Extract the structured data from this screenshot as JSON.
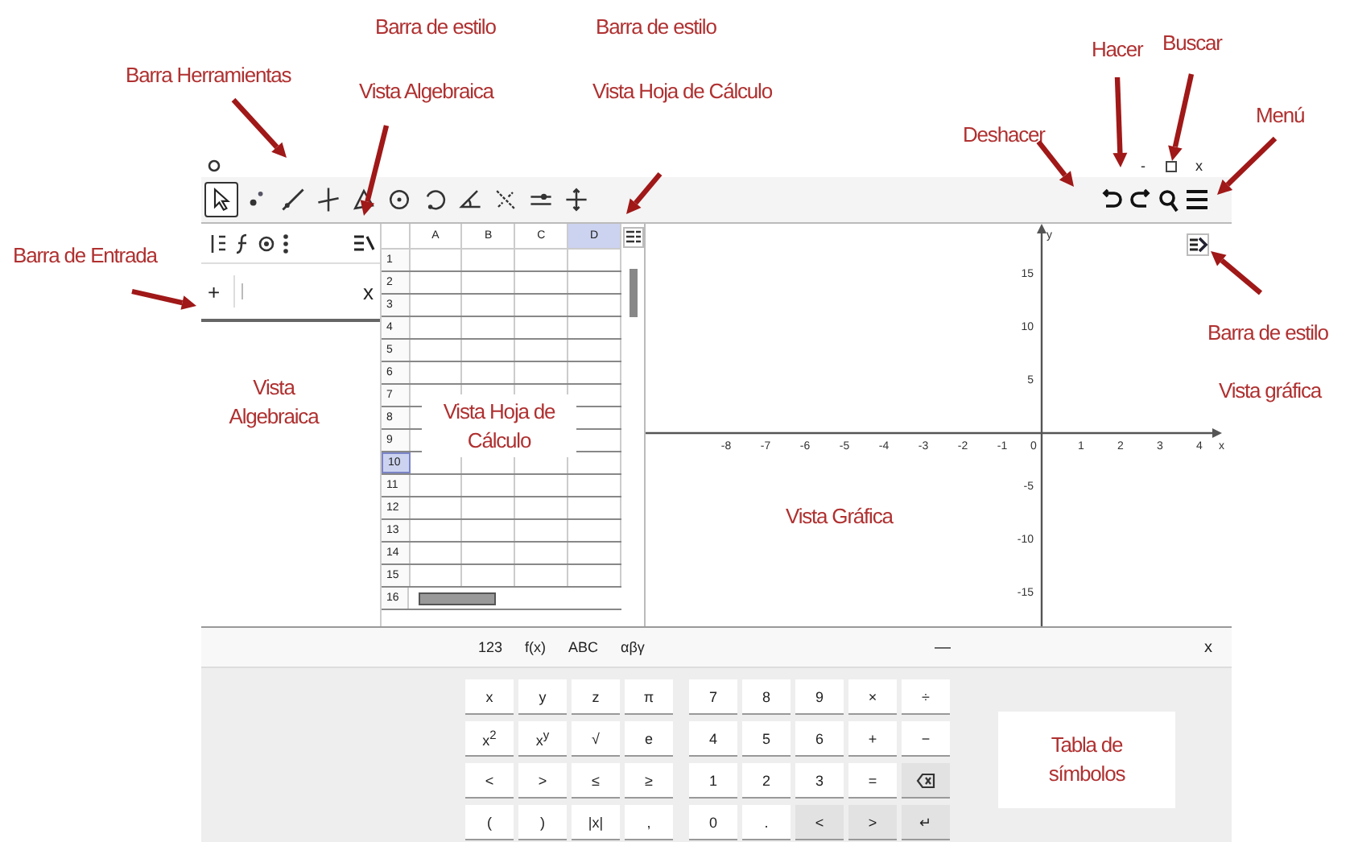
{
  "annotations": [
    {
      "text": "Barra de estilo"
    },
    {
      "text": "Barra de estilo"
    },
    {
      "text": "Barra Herramientas"
    },
    {
      "text": "Vista Algebraica"
    },
    {
      "text": "Vista Hoja de Cálculo"
    },
    {
      "text": "Deshacer"
    },
    {
      "text": "Hacer"
    },
    {
      "text": "Buscar"
    },
    {
      "text": "Menú"
    },
    {
      "text": "Barra de Entrada"
    },
    {
      "text": "Barra de estilo"
    },
    {
      "text": "Vista gráfica"
    },
    {
      "text": "Vista Algebraica"
    },
    {
      "text": "Vista Hoja de Cálculo"
    },
    {
      "text": "Vista Gráfica"
    }
  ],
  "window_controls": {
    "minimize": "-",
    "close": "x"
  },
  "tools": [
    {
      "selected": true
    },
    {
      "selected": false
    },
    {
      "selected": false
    },
    {
      "selected": false
    },
    {
      "selected": false
    },
    {
      "selected": false
    },
    {
      "selected": false
    },
    {
      "selected": false
    },
    {
      "selected": false
    },
    {
      "selected": false
    },
    {
      "selected": false
    }
  ],
  "algebra": {
    "input_prefix": "+",
    "clear": "x"
  },
  "spreadsheet": {
    "columns": [
      {
        "label": "A",
        "selected": false
      },
      {
        "label": "B",
        "selected": false
      },
      {
        "label": "C",
        "selected": false
      },
      {
        "label": "D",
        "selected": true
      }
    ],
    "rows": [
      {
        "label": "1",
        "selected": false
      },
      {
        "label": "2",
        "selected": false
      },
      {
        "label": "3",
        "selected": false
      },
      {
        "label": "4",
        "selected": false
      },
      {
        "label": "5",
        "selected": false
      },
      {
        "label": "6",
        "selected": false
      },
      {
        "label": "7",
        "selected": false
      },
      {
        "label": "8",
        "selected": false
      },
      {
        "label": "9",
        "selected": false
      },
      {
        "label": "10",
        "selected": true
      },
      {
        "label": "11",
        "selected": false
      },
      {
        "label": "12",
        "selected": false
      },
      {
        "label": "13",
        "selected": false
      },
      {
        "label": "14",
        "selected": false
      },
      {
        "label": "15",
        "selected": false
      },
      {
        "label": "16",
        "selected": false
      }
    ]
  },
  "graphics": {
    "x_label": "x",
    "y_label": "y",
    "x_ticks": [
      "-8",
      "-7",
      "-6",
      "-5",
      "-4",
      "-3",
      "-2",
      "-1",
      "0",
      "1",
      "2",
      "3",
      "4"
    ],
    "y_ticks": [
      "15",
      "10",
      "5",
      "-5",
      "-10",
      "-15"
    ]
  },
  "keyboard": {
    "tabs": [
      "123",
      "f(x)",
      "ABC",
      "αβγ"
    ],
    "minimize": "—",
    "close": "x",
    "keys": [
      [
        {
          "label": "x",
          "kind": "char"
        },
        {
          "label": "y",
          "kind": "char"
        },
        {
          "label": "z",
          "kind": "char"
        },
        {
          "label": "π",
          "kind": "char"
        },
        {
          "label": "7",
          "kind": "char"
        },
        {
          "label": "8",
          "kind": "char"
        },
        {
          "label": "9",
          "kind": "char"
        },
        {
          "label": "×",
          "kind": "char"
        },
        {
          "label": "÷",
          "kind": "char"
        }
      ],
      [
        {
          "label": "x$^{2}$",
          "kind": "char"
        },
        {
          "label": "x$^{y}$",
          "kind": "char"
        },
        {
          "label": "√",
          "kind": "char"
        },
        {
          "label": "e",
          "kind": "char"
        },
        {
          "label": "4",
          "kind": "char"
        },
        {
          "label": "5",
          "kind": "char"
        },
        {
          "label": "6",
          "kind": "char"
        },
        {
          "label": "+",
          "kind": "char"
        },
        {
          "label": "−",
          "kind": "char"
        }
      ],
      [
        {
          "label": "<",
          "kind": "char"
        },
        {
          "label": ">",
          "kind": "char"
        },
        {
          "label": "≤",
          "kind": "char"
        },
        {
          "label": "≥",
          "kind": "char"
        },
        {
          "label": "1",
          "kind": "char"
        },
        {
          "label": "2",
          "kind": "char"
        },
        {
          "label": "3",
          "kind": "char"
        },
        {
          "label": "=",
          "kind": "char"
        },
        {
          "kind": "backspace"
        }
      ],
      [
        {
          "label": "(",
          "kind": "char"
        },
        {
          "label": ")",
          "kind": "char"
        },
        {
          "label": "|x|",
          "kind": "char"
        },
        {
          "label": ",",
          "kind": "char"
        },
        {
          "label": "0",
          "kind": "char"
        },
        {
          "label": ".",
          "kind": "char"
        },
        {
          "label": "<",
          "kind": "function"
        },
        {
          "label": ">",
          "kind": "function"
        },
        {
          "label": "↵",
          "kind": "function"
        }
      ]
    ],
    "symbol_table_label": "Tabla de símbolos"
  }
}
